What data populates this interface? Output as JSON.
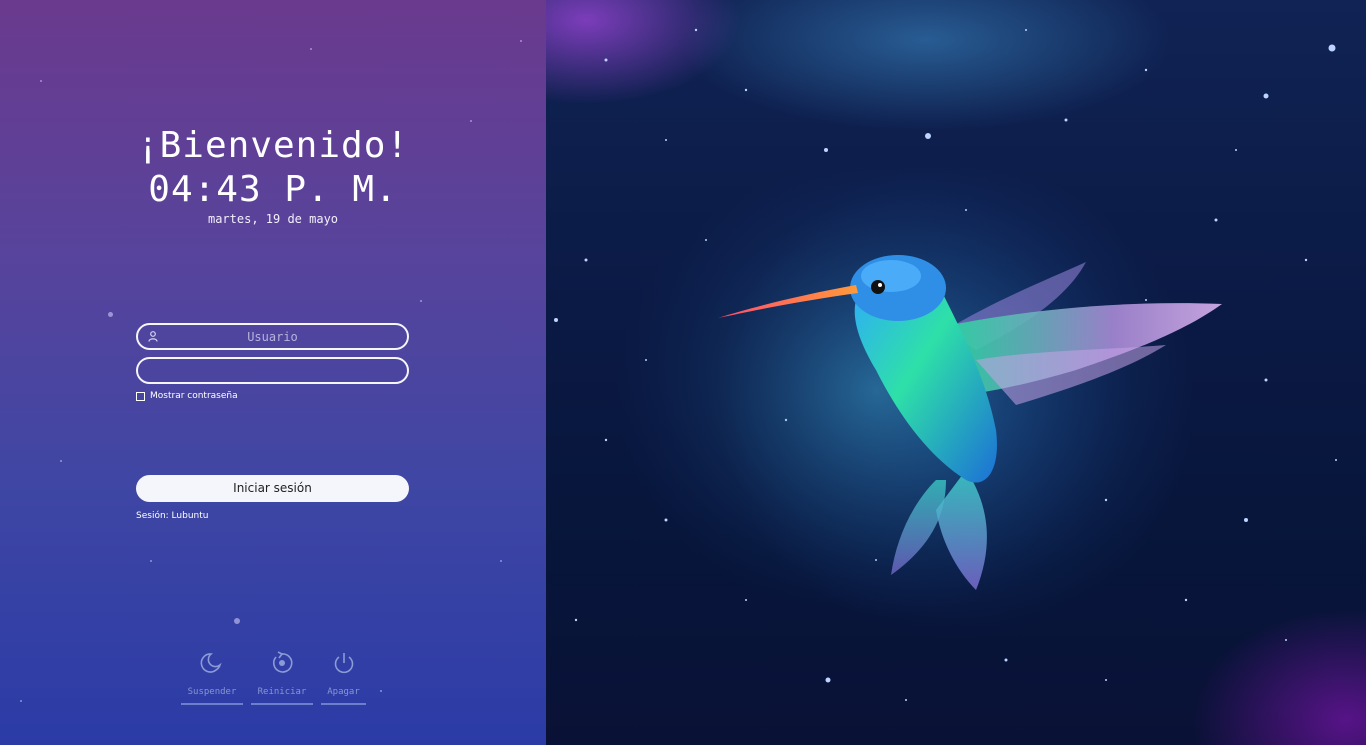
{
  "greeter": {
    "welcome": "¡Bienvenido!",
    "time": "04:43 P. M.",
    "date": "martes, 19 de mayo",
    "username_placeholder": "Usuario",
    "password_value": "",
    "show_password_label": "Mostrar contraseña",
    "show_password_checked": false,
    "login_label": "Iniciar sesión",
    "session_label": "Sesión: Lubuntu"
  },
  "power": {
    "suspend": {
      "label": "Suspender",
      "icon": "moon-icon"
    },
    "restart": {
      "label": "Reiniciar",
      "icon": "restart-icon"
    },
    "shutdown": {
      "label": "Apagar",
      "icon": "power-icon"
    }
  },
  "colors": {
    "panel_top": "#6a3a8e",
    "panel_bottom": "#2b3ba6",
    "button_bg": "#f5f6fb"
  }
}
